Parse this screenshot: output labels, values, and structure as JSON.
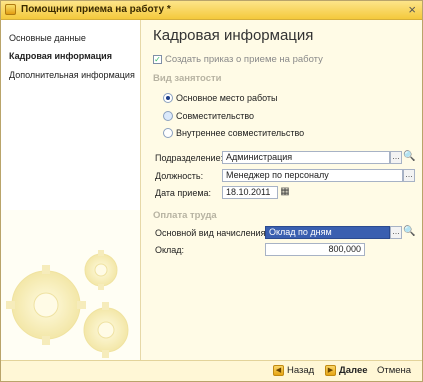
{
  "window": {
    "title": "Помощник приема на работу *",
    "close_symbol": "×"
  },
  "sidebar": {
    "items": [
      {
        "label": "Основные данные"
      },
      {
        "label": "Кадровая информация"
      },
      {
        "label": "Дополнительная информация"
      }
    ]
  },
  "main": {
    "heading": "Кадровая информация",
    "create_order": {
      "label": "Создать приказ о приеме на работу",
      "checked": true
    },
    "employment_section": "Вид занятости",
    "employment_options": [
      {
        "label": "Основное место работы",
        "selected": true
      },
      {
        "label": "Совместительство",
        "selected": false
      },
      {
        "label": "Внутреннее совместительство",
        "selected": false
      }
    ],
    "department": {
      "label": "Подразделение:",
      "value": "Администрация"
    },
    "position": {
      "label": "Должность:",
      "value": "Менеджер по персоналу"
    },
    "hire_date": {
      "label": "Дата приема:",
      "value": "18.10.2011"
    },
    "pay_section": "Оплата труда",
    "accrual_type": {
      "label": "Основной вид начисления:",
      "value": "Оклад по дням"
    },
    "salary": {
      "label": "Оклад:",
      "value": "800,000"
    }
  },
  "footer": {
    "back_label": "Назад",
    "next_label": "Далее",
    "cancel_label": "Отмена"
  },
  "colors": {
    "title_bar": "#f4c93c",
    "selection": "#3a5fb0",
    "section": "#b7b3a2"
  }
}
